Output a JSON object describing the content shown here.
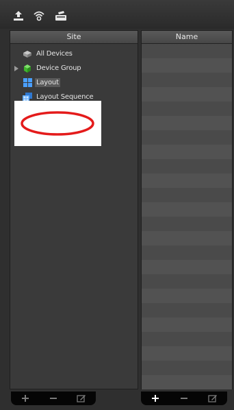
{
  "site_panel": {
    "header": "Site",
    "items": [
      {
        "label": "All Devices",
        "icon": "all-devices-icon",
        "expandable": false,
        "selected": false
      },
      {
        "label": "Device Group",
        "icon": "device-group-icon",
        "expandable": true,
        "selected": false
      },
      {
        "label": "Layout",
        "icon": "layout-icon",
        "expandable": false,
        "selected": true
      },
      {
        "label": "Layout Sequence",
        "icon": "layout-sequence-icon",
        "expandable": false,
        "selected": false
      }
    ]
  },
  "name_panel": {
    "header": "Name"
  },
  "toolbar": {
    "icons": [
      "upload-icon",
      "wireless-icon",
      "card-reader-icon"
    ]
  },
  "colors": {
    "annotation": "#e41b1b",
    "panel_bg": "#3a3a3a",
    "selection": "#5a5a5a"
  }
}
